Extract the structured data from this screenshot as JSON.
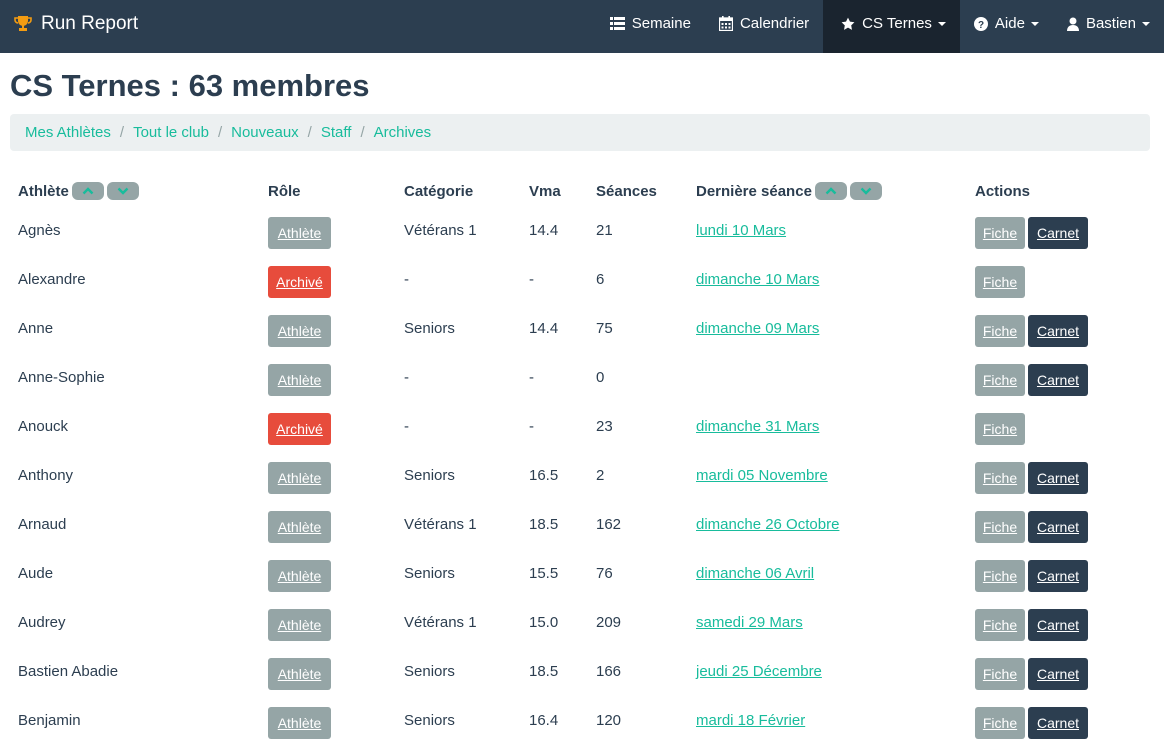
{
  "app": {
    "brand": "Run Report"
  },
  "nav": {
    "semaine": "Semaine",
    "calendrier": "Calendrier",
    "club": "CS Ternes",
    "aide": "Aide",
    "user": "Bastien"
  },
  "page": {
    "title": "CS Ternes : 63 membres"
  },
  "breadcrumb": [
    "Mes Athlètes",
    "Tout le club",
    "Nouveaux",
    "Staff",
    "Archives"
  ],
  "table": {
    "headers": {
      "athlete": "Athlète",
      "role": "Rôle",
      "categorie": "Catégorie",
      "vma": "Vma",
      "seances": "Séances",
      "derniere": "Dernière séance",
      "actions": "Actions"
    },
    "buttons": {
      "fiche": "Fiche",
      "carnet": "Carnet"
    },
    "rows": [
      {
        "name": "Agnès",
        "role": "Athlète",
        "archived": false,
        "categorie": "Vétérans 1",
        "vma": "14.4",
        "seances": "21",
        "date": "lundi 10 Mars",
        "carnet": true
      },
      {
        "name": "Alexandre",
        "role": "Archivé",
        "archived": true,
        "categorie": "-",
        "vma": "-",
        "seances": "6",
        "date": "dimanche 10 Mars",
        "carnet": false
      },
      {
        "name": "Anne",
        "role": "Athlète",
        "archived": false,
        "categorie": "Seniors",
        "vma": "14.4",
        "seances": "75",
        "date": "dimanche 09 Mars",
        "carnet": true
      },
      {
        "name": "Anne-Sophie",
        "role": "Athlète",
        "archived": false,
        "categorie": "-",
        "vma": "-",
        "seances": "0",
        "date": "",
        "carnet": true
      },
      {
        "name": "Anouck",
        "role": "Archivé",
        "archived": true,
        "categorie": "-",
        "vma": "-",
        "seances": "23",
        "date": "dimanche 31 Mars",
        "carnet": false
      },
      {
        "name": "Anthony",
        "role": "Athlète",
        "archived": false,
        "categorie": "Seniors",
        "vma": "16.5",
        "seances": "2",
        "date": "mardi 05 Novembre",
        "carnet": true
      },
      {
        "name": "Arnaud",
        "role": "Athlète",
        "archived": false,
        "categorie": "Vétérans 1",
        "vma": "18.5",
        "seances": "162",
        "date": "dimanche 26 Octobre",
        "carnet": true
      },
      {
        "name": "Aude",
        "role": "Athlète",
        "archived": false,
        "categorie": "Seniors",
        "vma": "15.5",
        "seances": "76",
        "date": "dimanche 06 Avril",
        "carnet": true
      },
      {
        "name": "Audrey",
        "role": "Athlète",
        "archived": false,
        "categorie": "Vétérans 1",
        "vma": "15.0",
        "seances": "209",
        "date": "samedi 29 Mars",
        "carnet": true
      },
      {
        "name": "Bastien Abadie",
        "role": "Athlète",
        "archived": false,
        "categorie": "Seniors",
        "vma": "18.5",
        "seances": "166",
        "date": "jeudi 25 Décembre",
        "carnet": true
      },
      {
        "name": "Benjamin",
        "role": "Athlète",
        "archived": false,
        "categorie": "Seniors",
        "vma": "16.4",
        "seances": "120",
        "date": "mardi 18 Février",
        "carnet": true
      }
    ]
  }
}
